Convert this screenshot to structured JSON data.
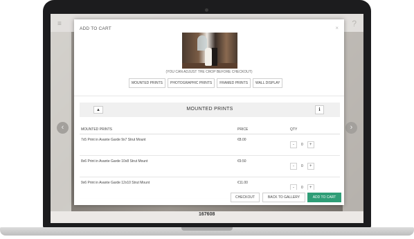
{
  "background": {
    "menu_icon": "≡",
    "help_icon": "?",
    "image_id": "167608",
    "left_arrow": "‹",
    "right_arrow": "›"
  },
  "modal": {
    "title": "ADD TO CART",
    "close": "×",
    "crop_note": "(YOU CAN ADJUST THE CROP BEFORE CHECKOUT)",
    "tabs": [
      "MOUNTED PRINTS",
      "PHOTOGRAPHIC PRINTS",
      "FRAMED PRINTS",
      "WALL DISPLAY"
    ],
    "section": {
      "collapse_icon": "▲",
      "title": "MOUNTED PRINTS",
      "info_icon": "i"
    },
    "columns": {
      "name": "MOUNTED PRINTS",
      "price": "PRICE",
      "qty": "QTY"
    },
    "rows": [
      {
        "name": "7x5 Print in Avante Garde 9x7 Strut Mount",
        "price": "€8.00",
        "qty": "0"
      },
      {
        "name": "8x6 Print in Avante Garde 10x8 Strut Mount",
        "price": "€9.50",
        "qty": "0"
      },
      {
        "name": "9x6 Print in Avante Garde 12x10 Strut Mount",
        "price": "€11.00",
        "qty": "0"
      }
    ],
    "stepper": {
      "minus": "-",
      "plus": "+"
    },
    "footer": {
      "checkout": "CHECKOUT",
      "back": "BACK TO GALLERY",
      "add": "ADD TO CART"
    },
    "colors": {
      "primary": "#2f9e77"
    }
  }
}
